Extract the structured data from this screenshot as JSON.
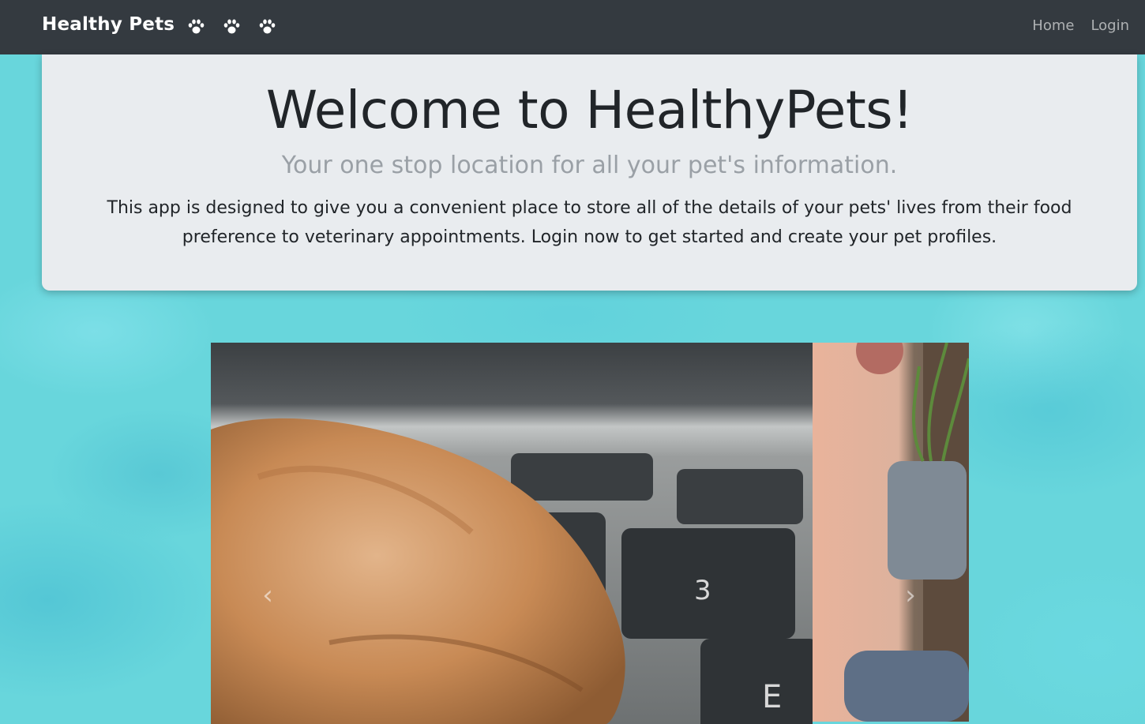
{
  "navbar": {
    "brand": "Healthy Pets",
    "paw_icons": [
      "paw-icon",
      "paw-icon",
      "paw-icon"
    ],
    "links": [
      {
        "label": "Home"
      },
      {
        "label": "Login"
      }
    ]
  },
  "jumbotron": {
    "title": "Welcome to HealthyPets!",
    "lead": "Your one stop location for all your pet's information.",
    "text": "This app is designed to give you a convenient place to store all of the details of your pets' lives from their food preference to veterinary appointments. Login now to get started and create your pet profiles."
  },
  "carousel": {
    "slides": [
      {
        "name": "cat-paw-on-laptop-photo"
      },
      {
        "name": "person-with-plant-photo"
      }
    ],
    "prev_icon": "chevron-left-icon",
    "next_icon": "chevron-right-icon",
    "prev_glyph": "‹",
    "next_glyph": "›"
  },
  "colors": {
    "navbar_bg": "#343a40",
    "jumbotron_bg": "#e9ecef",
    "page_bg": "#68d6dc"
  }
}
